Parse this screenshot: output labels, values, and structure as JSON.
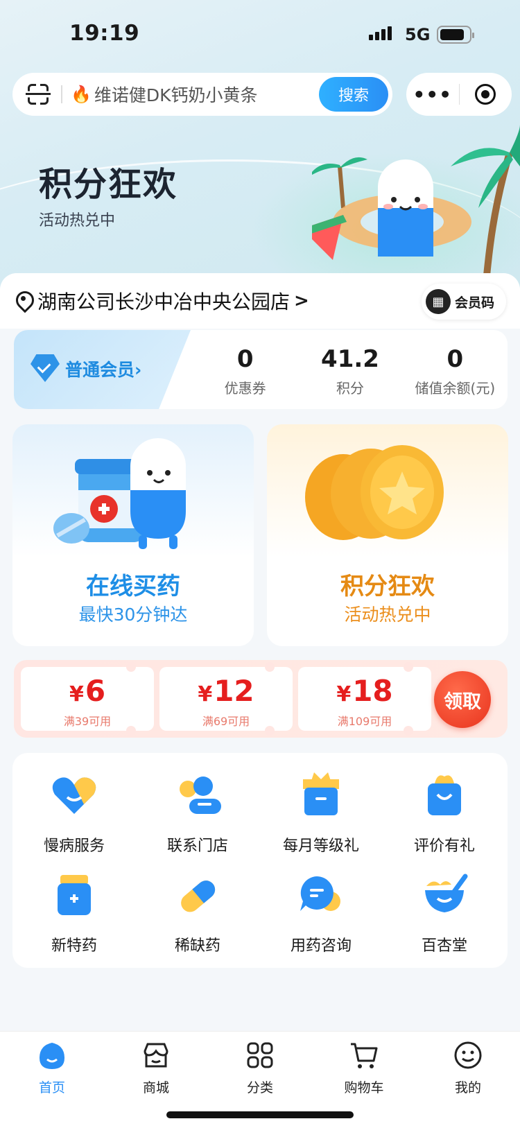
{
  "status_bar": {
    "time": "19:19",
    "network": "5G"
  },
  "search": {
    "placeholder": "维诺健DK钙奶小黄条",
    "button": "搜索"
  },
  "capsule": {
    "more": "•••"
  },
  "banner": {
    "title": "积分狂欢",
    "subtitle": "活动热兑中"
  },
  "store": {
    "name": "湖南公司长沙中冶中央公园店",
    "chevron": ">",
    "member_code": "会员码"
  },
  "member": {
    "level": "普通会员",
    "chevron": "›",
    "stats": [
      {
        "value": "0",
        "label": "优惠券"
      },
      {
        "value": "41.2",
        "label": "积分"
      },
      {
        "value": "0",
        "label": "储值余额(元)"
      }
    ]
  },
  "cards": [
    {
      "title": "在线买药",
      "subtitle": "最快30分钟达"
    },
    {
      "title": "积分狂欢",
      "subtitle": "活动热兑中"
    }
  ],
  "coupons": {
    "currency": "¥",
    "items": [
      {
        "amount": "6",
        "condition": "满39可用"
      },
      {
        "amount": "12",
        "condition": "满69可用"
      },
      {
        "amount": "18",
        "condition": "满109可用"
      }
    ],
    "claim": "领取"
  },
  "services": [
    {
      "label": "慢病服务",
      "icon": "heart-icon"
    },
    {
      "label": "联系门店",
      "icon": "contact-icon"
    },
    {
      "label": "每月等级礼",
      "icon": "gift-icon"
    },
    {
      "label": "评价有礼",
      "icon": "shopping-bag-icon"
    },
    {
      "label": "新特药",
      "icon": "medicine-bottle-icon"
    },
    {
      "label": "稀缺药",
      "icon": "pill-icon"
    },
    {
      "label": "用药咨询",
      "icon": "chat-icon"
    },
    {
      "label": "百杏堂",
      "icon": "mortar-icon"
    }
  ],
  "tabs": [
    {
      "label": "首页",
      "icon": "home-icon",
      "active": true
    },
    {
      "label": "商城",
      "icon": "store-icon",
      "active": false
    },
    {
      "label": "分类",
      "icon": "category-icon",
      "active": false
    },
    {
      "label": "购物车",
      "icon": "cart-icon",
      "active": false
    },
    {
      "label": "我的",
      "icon": "profile-icon",
      "active": false
    }
  ],
  "colors": {
    "brand_blue": "#2a8ff5",
    "points_orange": "#e58a14",
    "coupon_red": "#e51e1e"
  }
}
